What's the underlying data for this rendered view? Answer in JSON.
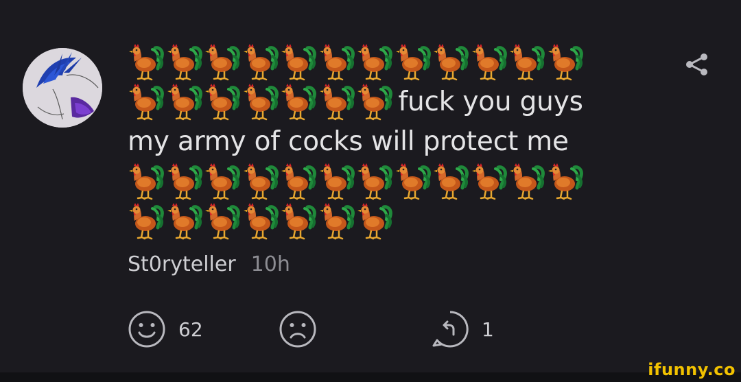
{
  "post": {
    "text_line_2": "fuck you guys",
    "text_line_3": "my army of cocks will protect me",
    "author": "St0ryteller",
    "time": "10h",
    "emoji": "rooster-emoji",
    "emoji_rows": [
      12,
      7,
      12,
      7
    ]
  },
  "actions": {
    "like_count": "62",
    "reply_count": "1"
  },
  "watermark": "ifunny.co",
  "colors": {
    "background": "#1b1a1f",
    "text": "#e4e4e6",
    "meta": "#8d8d93",
    "icon": "#b9b9bf",
    "watermark": "#f2c200"
  }
}
